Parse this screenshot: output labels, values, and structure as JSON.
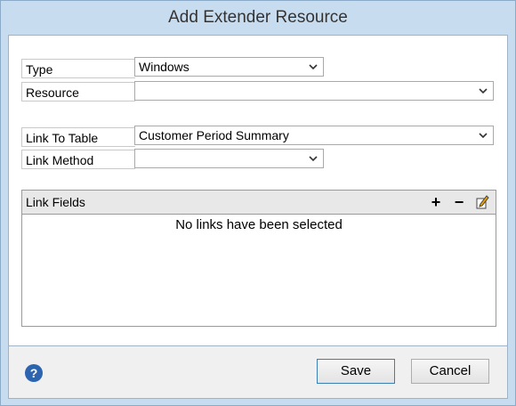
{
  "window": {
    "title": "Add Extender Resource"
  },
  "form": {
    "type": {
      "label": "Type",
      "value": "Windows"
    },
    "resource": {
      "label": "Resource",
      "value": ""
    },
    "link_to_table": {
      "label": "Link To Table",
      "value": "Customer Period Summary"
    },
    "link_method": {
      "label": "Link Method",
      "value": ""
    }
  },
  "link_fields": {
    "title": "Link Fields",
    "empty_message": "No links have been selected",
    "tools": {
      "add": "+",
      "remove": "−"
    }
  },
  "footer": {
    "help_icon": "?",
    "save_label": "Save",
    "cancel_label": "Cancel"
  }
}
